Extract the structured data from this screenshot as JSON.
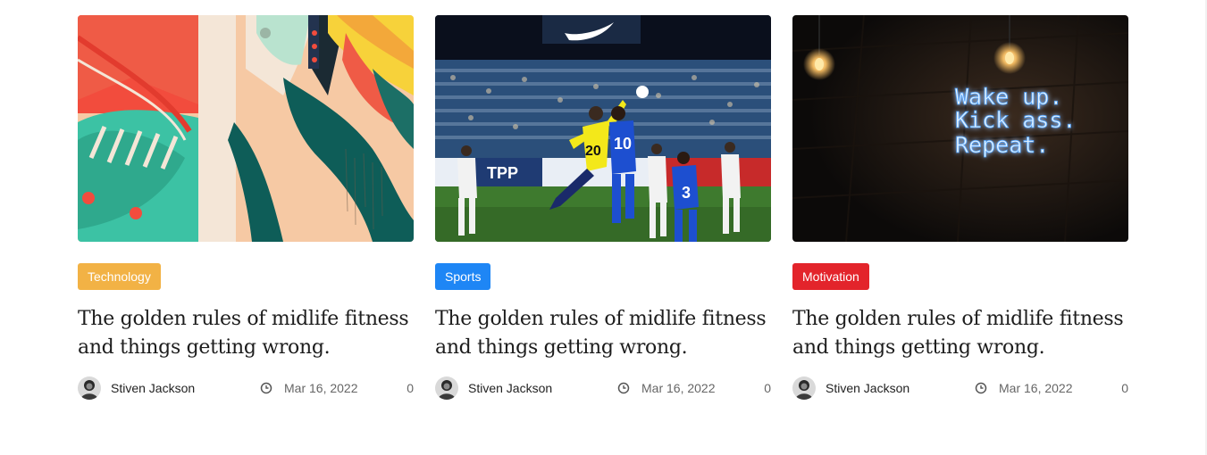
{
  "posts": [
    {
      "category": "Technology",
      "category_color": "#f2b245",
      "title": "The golden rules of midlife fitness and things getting wrong.",
      "author": "Stiven Jackson",
      "date": "Mar 16, 2022",
      "comments": "0",
      "image": "abstract-painting"
    },
    {
      "category": "Sports",
      "category_color": "#1e86f5",
      "title": "The golden rules of midlife fitness and things getting wrong.",
      "author": "Stiven Jackson",
      "date": "Mar 16, 2022",
      "comments": "0",
      "image": "football-match"
    },
    {
      "category": "Motivation",
      "category_color": "#e3242b",
      "title": "The golden rules of midlife fitness and things getting wrong.",
      "author": "Stiven Jackson",
      "date": "Mar 16, 2022",
      "comments": "0",
      "image": "neon-sign",
      "neon_lines": [
        "Wake up.",
        "Kick ass.",
        "Repeat."
      ]
    }
  ]
}
